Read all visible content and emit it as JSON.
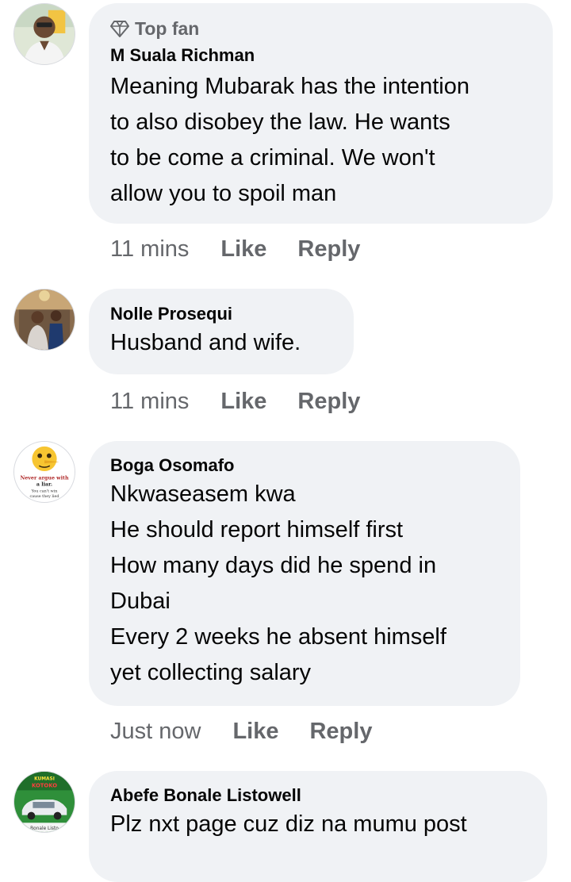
{
  "comments": [
    {
      "badge": "Top fan",
      "badge_icon": "diamond-icon",
      "author": "M Suala Richman",
      "lines": [
        "Meaning Mubarak has the intention",
        "to also disobey the law. He wants",
        "to be come a criminal. We won't",
        "allow you to spoil man"
      ],
      "time": "11 mins",
      "like": "Like",
      "reply": "Reply"
    },
    {
      "author": "Nolle Prosequi",
      "lines": [
        "Husband and wife."
      ],
      "time": "11 mins",
      "like": "Like",
      "reply": "Reply"
    },
    {
      "author": "Boga Osomafo",
      "avatar_text": [
        "Never argue with",
        "a liar.",
        "You can't win",
        "cause they lied"
      ],
      "lines": [
        "Nkwaseasem kwa",
        "He should report himself first",
        "How many days did he spend in",
        "Dubai",
        "Every 2 weeks he absent himself",
        "yet collecting salary"
      ],
      "time": "Just now",
      "like": "Like",
      "reply": "Reply"
    },
    {
      "author": "Abefe Bonale Listowell",
      "avatar_text": [
        "KUMASI",
        "KOTOKO",
        "Bonale Listo"
      ],
      "lines": [
        "Plz nxt page cuz diz na mumu post"
      ]
    }
  ],
  "colors": {
    "bubble": "#f0f2f5",
    "secondary_text": "#65676b",
    "primary_text": "#050505"
  }
}
